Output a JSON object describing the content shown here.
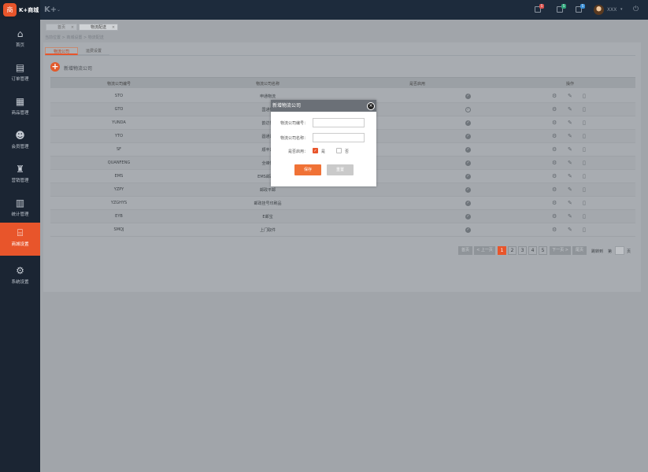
{
  "app": {
    "name": "K+商城",
    "logo_glyph": "K+",
    "logo_badge": "商",
    "user": "XXX"
  },
  "topbar": {
    "badges": [
      "5",
      "5",
      "5"
    ],
    "badge_colors": [
      "#d9534f",
      "#2fa37a",
      "#3a8fd6"
    ]
  },
  "sidebar": {
    "items": [
      {
        "label": "首页",
        "icon": "home-icon"
      },
      {
        "label": "订单管理",
        "icon": "order-icon"
      },
      {
        "label": "商品管理",
        "icon": "product-icon"
      },
      {
        "label": "会员管理",
        "icon": "member-icon"
      },
      {
        "label": "营销管理",
        "icon": "marketing-icon"
      },
      {
        "label": "统计管理",
        "icon": "stats-icon"
      },
      {
        "label": "商城设置",
        "icon": "store-icon"
      },
      {
        "label": "系统设置",
        "icon": "gear-icon"
      }
    ]
  },
  "tabs": [
    {
      "label": "首页"
    },
    {
      "label": "物流配送"
    }
  ],
  "breadcrumb": "当前位置 > 商城设置 > 物流配送",
  "subtabs": [
    "物流公司",
    "运费设置"
  ],
  "add_label": "新增物流公司",
  "table": {
    "headers": [
      "物流公司编号",
      "物流公司名称",
      "是否启用",
      "操作"
    ],
    "rows": [
      {
        "code": "STO",
        "name": "申通物流",
        "enabled": true
      },
      {
        "code": "GTO",
        "name": "国通快",
        "enabled": false
      },
      {
        "code": "YUNDA",
        "name": "韵达快",
        "enabled": true
      },
      {
        "code": "YTO",
        "name": "圆通速",
        "enabled": true
      },
      {
        "code": "SF",
        "name": "顺丰速",
        "enabled": true
      },
      {
        "code": "QUANFENG",
        "name": "全峰快",
        "enabled": true
      },
      {
        "code": "EMS",
        "name": "EMS邮政快",
        "enabled": true
      },
      {
        "code": "YZPY",
        "name": "邮政平邮",
        "enabled": true
      },
      {
        "code": "YZGHYS",
        "name": "邮政挂号印刷品",
        "enabled": true
      },
      {
        "code": "EYB",
        "name": "E邮宝",
        "enabled": true
      },
      {
        "code": "SMQJ",
        "name": "上门取件",
        "enabled": true
      }
    ]
  },
  "pager": {
    "first": "首页",
    "prev": "< 上一页",
    "pages": [
      "1",
      "2",
      "3",
      "4",
      "5"
    ],
    "current": "1",
    "next": "下一页 >",
    "last": "尾页",
    "goto_label": "跳转到",
    "page_label": "第",
    "page_unit": "页"
  },
  "modal": {
    "title": "新增物流公司",
    "code_label": "物流公司编号：",
    "name_label": "物流公司名称：",
    "enabled_label": "是否启用：",
    "yes": "是",
    "no": "否",
    "save": "保存",
    "reset": "重置"
  }
}
